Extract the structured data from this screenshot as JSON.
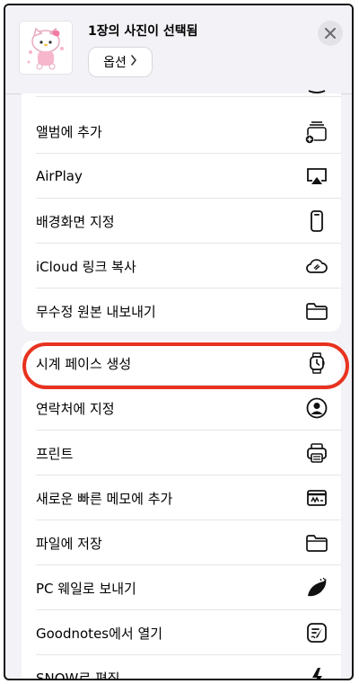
{
  "header": {
    "title": "1장의 사진이 선택됨",
    "options_label": "옵션",
    "thumbnail_icon": "hello-kitty-thumbnail",
    "close_icon": "close-icon"
  },
  "group1": [
    {
      "label": "",
      "icon": "partial-icon"
    },
    {
      "label": "앨범에 추가",
      "icon": "add-to-album-icon"
    },
    {
      "label": "AirPlay",
      "icon": "airplay-icon"
    },
    {
      "label": "배경화면 지정",
      "icon": "phone-icon"
    },
    {
      "label": "iCloud 링크 복사",
      "icon": "cloud-link-icon"
    },
    {
      "label": "무수정 원본 내보내기",
      "icon": "folder-icon"
    }
  ],
  "group2": [
    {
      "label": "시계 페이스 생성",
      "icon": "watch-icon"
    },
    {
      "label": "연락처에 지정",
      "icon": "contact-icon"
    },
    {
      "label": "프린트",
      "icon": "printer-icon"
    },
    {
      "label": "새로운 빠른 메모에 추가",
      "icon": "quick-note-icon"
    },
    {
      "label": "파일에 저장",
      "icon": "folder-icon"
    },
    {
      "label": "PC 웨일로 보내기",
      "icon": "whale-icon"
    },
    {
      "label": "Goodnotes에서 열기",
      "icon": "goodnotes-icon"
    },
    {
      "label": "SNOW로 편집",
      "icon": "snow-bolt-icon"
    }
  ],
  "colors": {
    "highlight": "#e8321f",
    "background": "#f2f2f7"
  }
}
